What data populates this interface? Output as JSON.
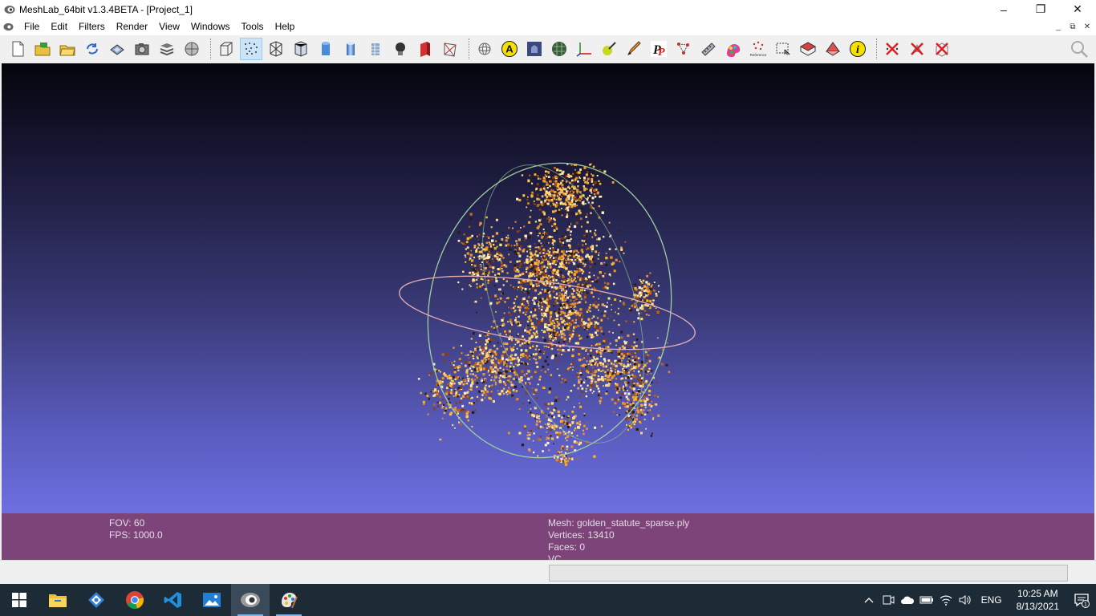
{
  "window": {
    "title": "MeshLab_64bit v1.3.4BETA - [Project_1]",
    "minimize": "–",
    "restore": "❐",
    "close": "✕"
  },
  "menu": {
    "items": [
      "File",
      "Edit",
      "Filters",
      "Render",
      "View",
      "Windows",
      "Tools",
      "Help"
    ],
    "mdi": {
      "minimize": "_",
      "restore": "⧉",
      "close": "✕"
    }
  },
  "toolbar": {
    "groups": [
      [
        "new-file-icon",
        "open-project-icon",
        "open-mesh-icon",
        "reload-icon",
        "save-icon",
        "snapshot-icon",
        "layers-icon",
        "raster-icon"
      ],
      [
        "bbox-icon",
        "points-icon",
        "wireframe-icon",
        "hidden-lines-icon",
        "flat-icon",
        "smooth-icon",
        "texture-icon",
        "light-icon",
        "backface-icon",
        "fancy-lighting-icon"
      ],
      [
        "trackball-icon",
        "annotation-a-icon",
        "shader-icon",
        "texture-tool-icon",
        "axis-icon",
        "paint-select-icon",
        "brush-icon",
        "pp-tool-icon",
        "align-icon",
        "measure-icon",
        "color-icon",
        "reference-icon",
        "select-vertices-icon",
        "select-faces-icon",
        "connected-select-icon",
        "info-icon"
      ],
      [
        "delete-vertices-icon",
        "delete-faces-icon",
        "delete-all-icon"
      ]
    ],
    "active": "points-icon",
    "reference_label": "Reference",
    "annotation_letter": "A",
    "info_letter": "i",
    "pp_letters": "P"
  },
  "info": {
    "fov": "FOV: 60",
    "fps": "FPS:  1000.0",
    "mesh": "Mesh: golden_statute_sparse.ply",
    "vertices": "Vertices: 13410",
    "faces": "Faces: 0",
    "vc": "VC"
  },
  "taskbar": {
    "apps": [
      "start-icon",
      "file-explorer-icon",
      "network-app-icon",
      "chrome-icon",
      "vscode-icon",
      "photos-icon",
      "meshlab-icon",
      "paint-icon"
    ],
    "active_app": "meshlab-icon",
    "tray": {
      "chevron": "^",
      "lang": "ENG",
      "time": "10:25 AM",
      "date": "8/13/2021",
      "notification_count": "1"
    }
  },
  "colors": {
    "viewport_top": "#05050c",
    "viewport_bottom": "#6d6fe0",
    "info_bg": "#7c4479",
    "taskbar_bg": "#1d2b36",
    "trackball_green": "#9ecfa0",
    "trackball_pink": "#e4b0b8"
  }
}
